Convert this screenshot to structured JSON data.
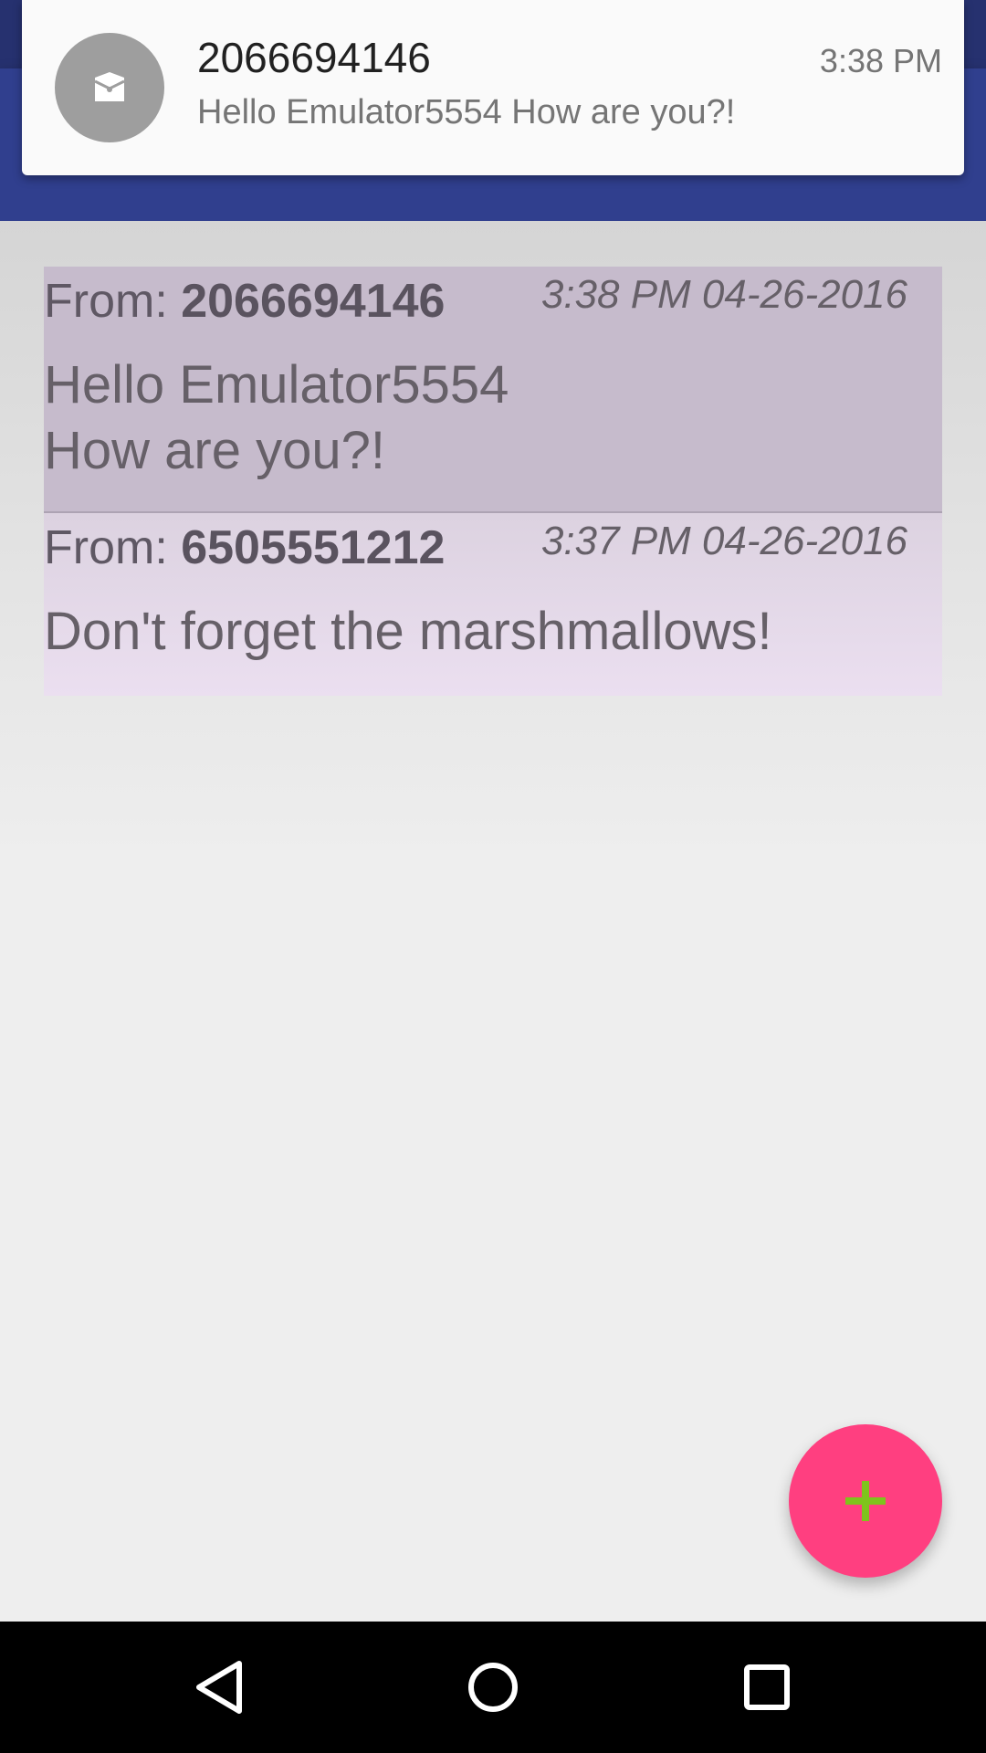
{
  "notification": {
    "title": "2066694146",
    "text": "Hello Emulator5554 How are you?!",
    "time": "3:38 PM",
    "icon": "message-icon"
  },
  "messages": [
    {
      "from_label": "From: ",
      "from_number": "2066694146",
      "timestamp": "3:38 PM 04-26-2016",
      "body_line1": "Hello Emulator5554",
      "body_line2": "How are you?!"
    },
    {
      "from_label": "From: ",
      "from_number": "6505551212",
      "timestamp": "3:37 PM 04-26-2016",
      "body_line1": "Don't forget the marshmallows!"
    }
  ],
  "fab": {
    "icon": "plus-icon",
    "color": "#ff3f80",
    "icon_color": "#7fc31c"
  },
  "colors": {
    "status_bar": "#26316f",
    "toolbar": "#303f8e",
    "message_1_bg": "#c6bbcc",
    "message_2_bg": "#ebdff0"
  },
  "nav": {
    "back": "back-icon",
    "home": "home-icon",
    "recents": "recents-icon"
  }
}
